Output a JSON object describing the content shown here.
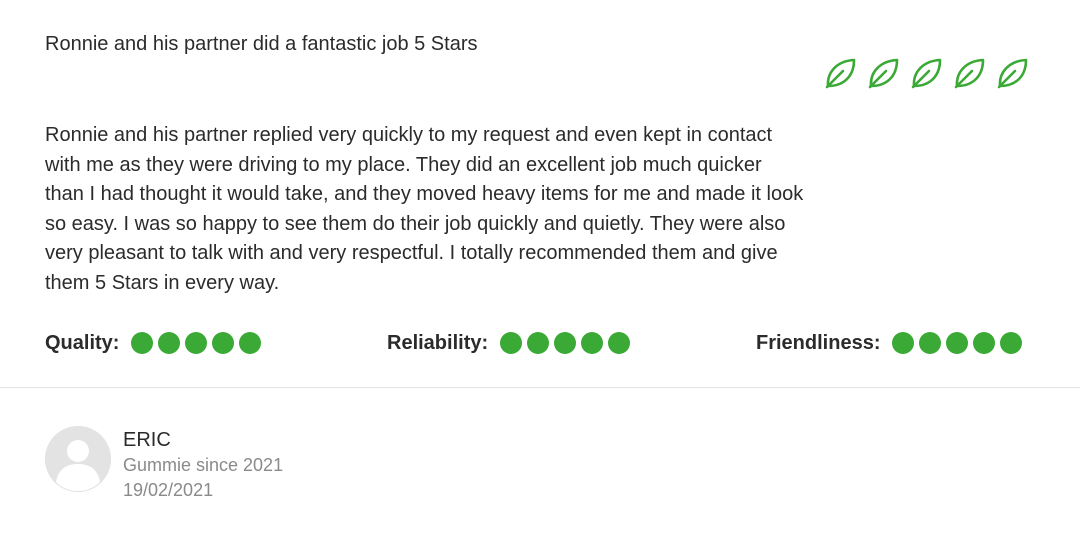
{
  "review": {
    "title": "Ronnie and his partner did a fantastic job 5 Stars",
    "rating": 5,
    "rating_max": 5,
    "rating_icon": "leaf-icon",
    "body": "Ronnie and his partner replied very quickly to my request and even kept in contact with me as they were driving to my place. They did an excellent job much quicker than I had thought it would take, and they moved heavy items for me and made it look so easy. I was so happy to see them do their job quickly and quietly. They were also very pleasant to talk with and very respectful. I totally recommended them and give them 5 Stars in every way."
  },
  "criteria": [
    {
      "label": "Quality:",
      "score": 5,
      "max": 5
    },
    {
      "label": "Reliability:",
      "score": 5,
      "max": 5
    },
    {
      "label": "Friendliness:",
      "score": 5,
      "max": 5
    }
  ],
  "author": {
    "name": "ERIC",
    "since": "Gummie since 2021",
    "date": "19/02/2021",
    "avatar_icon": "user-silhouette-icon"
  },
  "colors": {
    "accent_green": "#3aa935",
    "text": "#2b2b2b",
    "muted": "#8a8a8a"
  }
}
